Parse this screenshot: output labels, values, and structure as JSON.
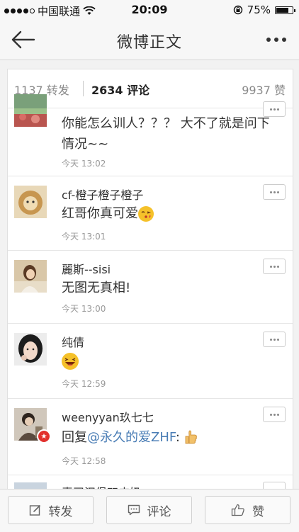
{
  "status_bar": {
    "carrier": "中国联通",
    "time": "20:09",
    "battery": "75%",
    "battery_level": 0.75
  },
  "navbar": {
    "title": "微博正文"
  },
  "tabs": {
    "repost": "1137 转发",
    "comment": "2634 评论",
    "like": "9937 赞"
  },
  "comments": [
    {
      "name": "",
      "text": "你能怎么训人？？？ 大不了就是问下情况~~",
      "time": "今天 13:02"
    },
    {
      "name": "cf-橙子橙子橙子",
      "text": "红哥你真可爱",
      "emoji": "kiss-emoji",
      "time": "今天 13:01"
    },
    {
      "name": "麗斯--sisi",
      "text": "无图无真相!",
      "time": "今天 13:00"
    },
    {
      "name": "纯倩",
      "emoji": "laugh-emoji",
      "time": "今天 12:59"
    },
    {
      "name": "weenyyan玖七七",
      "reply_prefix": "回复",
      "mention": "@永久的爱ZHF",
      "reply_suffix": ":",
      "emoji": "thumbs-up-emoji",
      "time": "今天 12:58"
    },
    {
      "name": "麦司汉堡双皮奶"
    }
  ],
  "toolbar": {
    "repost": "转发",
    "comment": "评论",
    "like": "赞"
  },
  "colors": {
    "mention": "#4a7db5",
    "badge": "#e2312d"
  }
}
